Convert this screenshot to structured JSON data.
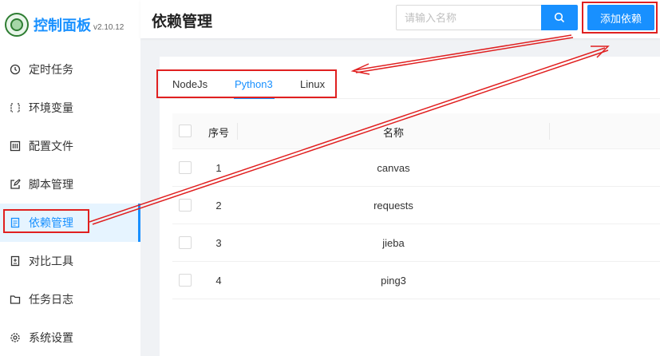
{
  "app": {
    "title": "控制面板",
    "version": "v2.10.12"
  },
  "sidebar": {
    "items": [
      {
        "label": "定时任务",
        "icon": "clock-icon",
        "active": false
      },
      {
        "label": "环境变量",
        "icon": "variable-icon",
        "active": false
      },
      {
        "label": "配置文件",
        "icon": "sliders-icon",
        "active": false
      },
      {
        "label": "脚本管理",
        "icon": "edit-icon",
        "active": false
      },
      {
        "label": "依赖管理",
        "icon": "file-text-icon",
        "active": true
      },
      {
        "label": "对比工具",
        "icon": "diff-icon",
        "active": false
      },
      {
        "label": "任务日志",
        "icon": "folder-icon",
        "active": false
      },
      {
        "label": "系统设置",
        "icon": "gear-icon",
        "active": false
      }
    ]
  },
  "header": {
    "title": "依赖管理",
    "search_placeholder": "请输入名称",
    "add_label": "添加依赖"
  },
  "tabs": [
    {
      "label": "NodeJs",
      "active": false
    },
    {
      "label": "Python3",
      "active": true
    },
    {
      "label": "Linux",
      "active": false
    }
  ],
  "table": {
    "columns": [
      "序号",
      "名称"
    ],
    "rows": [
      {
        "index": "1",
        "name": "canvas"
      },
      {
        "index": "2",
        "name": "requests"
      },
      {
        "index": "3",
        "name": "jieba"
      },
      {
        "index": "4",
        "name": "ping3"
      }
    ]
  },
  "colors": {
    "accent": "#1890ff",
    "annotation": "#e02020",
    "active_bg": "#e6f4ff"
  }
}
